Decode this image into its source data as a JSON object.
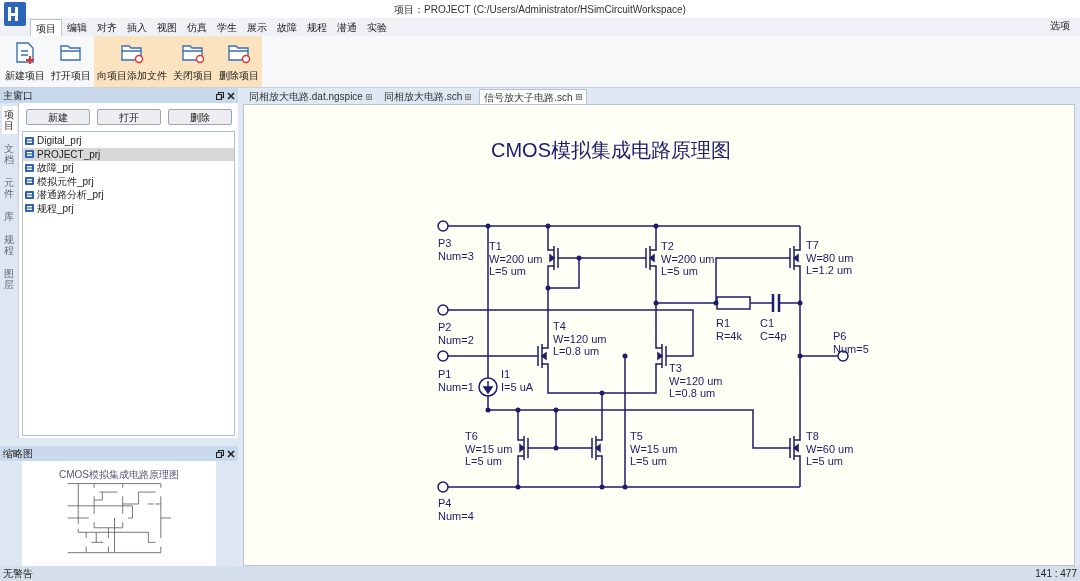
{
  "window": {
    "title": "项目：PROJECT (C:/Users/Administrator/HSimCircuitWorkspace)",
    "options": "选项"
  },
  "ribbon": {
    "tabs": [
      {
        "label": "项目",
        "selected": true
      },
      {
        "label": "编辑",
        "selected": false
      },
      {
        "label": "对齐",
        "selected": false
      },
      {
        "label": "插入",
        "selected": false
      },
      {
        "label": "视图",
        "selected": false
      },
      {
        "label": "仿真",
        "selected": false
      },
      {
        "label": "学生",
        "selected": false
      },
      {
        "label": "展示",
        "selected": false
      },
      {
        "label": "故障",
        "selected": false
      },
      {
        "label": "规程",
        "selected": false
      },
      {
        "label": "潜通",
        "selected": false
      },
      {
        "label": "实验",
        "selected": false
      }
    ],
    "buttons": [
      {
        "label": "新建项目",
        "highlighted": false
      },
      {
        "label": "打开项目",
        "highlighted": false
      },
      {
        "label": "向项目添加文件",
        "highlighted": true
      },
      {
        "label": "关闭项目",
        "highlighted": true
      },
      {
        "label": "删除项目",
        "highlighted": true
      }
    ]
  },
  "main_panel": {
    "title": "主窗口",
    "side_tabs": [
      {
        "label": "项目",
        "selected": true
      },
      {
        "label": "文档",
        "selected": false
      },
      {
        "label": "元件",
        "selected": false
      },
      {
        "label": "库",
        "selected": false
      },
      {
        "label": "规程",
        "selected": false
      },
      {
        "label": "图层",
        "selected": false
      }
    ],
    "buttons": [
      "新建",
      "打开",
      "删除"
    ],
    "projects": [
      {
        "label": "Digital_prj",
        "selected": false
      },
      {
        "label": "PROJECT_prj",
        "selected": true
      },
      {
        "label": "故障_prj",
        "selected": false
      },
      {
        "label": "模拟元件_prj",
        "selected": false
      },
      {
        "label": "潜通路分析_prj",
        "selected": false
      },
      {
        "label": "规程_prj",
        "selected": false
      }
    ]
  },
  "thumbnail_panel": {
    "title": "缩略图",
    "diagram_title": "CMOS模拟集成电路原理图"
  },
  "document_tabs": [
    {
      "label": "同相放大电路.dat.ngspice",
      "selected": false
    },
    {
      "label": "同相放大电路.sch",
      "selected": false
    },
    {
      "label": "信号放大子电路.sch",
      "selected": true
    }
  ],
  "schematic": {
    "title": "CMOS模拟集成电路原理图",
    "components": [
      {
        "kind": "port",
        "labels": [
          "P3",
          "Num=3"
        ]
      },
      {
        "kind": "port",
        "labels": [
          "P2",
          "Num=2"
        ]
      },
      {
        "kind": "port",
        "labels": [
          "P1",
          "Num=1"
        ]
      },
      {
        "kind": "port",
        "labels": [
          "P4",
          "Num=4"
        ]
      },
      {
        "kind": "port",
        "labels": [
          "P6",
          "Num=5"
        ]
      },
      {
        "kind": "transistor",
        "labels": [
          "T1",
          "W=200 um",
          "L=5 um"
        ]
      },
      {
        "kind": "transistor",
        "labels": [
          "T2",
          "W=200 um",
          "L=5 um"
        ]
      },
      {
        "kind": "transistor",
        "labels": [
          "T7",
          "W=80 um",
          "L=1.2 um"
        ]
      },
      {
        "kind": "transistor",
        "labels": [
          "T4",
          "W=120 um",
          "L=0.8 um"
        ]
      },
      {
        "kind": "transistor",
        "labels": [
          "T3",
          "W=120 um",
          "L=0.8 um"
        ]
      },
      {
        "kind": "transistor",
        "labels": [
          "T6",
          "W=15 um",
          "L=5 um"
        ]
      },
      {
        "kind": "transistor",
        "labels": [
          "T5",
          "W=15 um",
          "L=5 um"
        ]
      },
      {
        "kind": "transistor",
        "labels": [
          "T8",
          "W=60 um",
          "L=5 um"
        ]
      },
      {
        "kind": "resistor",
        "labels": [
          "R1",
          "R=4k"
        ]
      },
      {
        "kind": "capacitor",
        "labels": [
          "C1",
          "C=4p"
        ]
      },
      {
        "kind": "current_source",
        "labels": [
          "I1",
          "I=5 uA"
        ]
      }
    ]
  },
  "status_bar": {
    "message": "无警告",
    "position": "141 : 477"
  }
}
